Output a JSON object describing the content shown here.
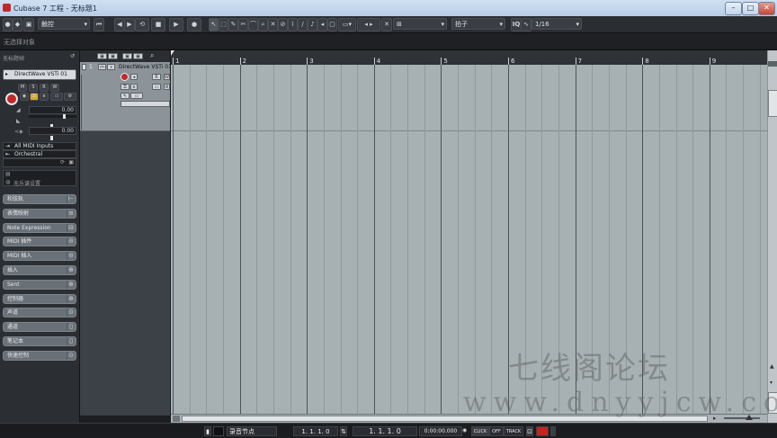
{
  "window": {
    "title": "Cubase 7 工程 - 无标题1",
    "min": "–",
    "max": "□",
    "close": "✕"
  },
  "toolbar": {
    "mode_select": "触控",
    "quantize_type": "拍子",
    "quantize_label": "IQ",
    "quantize_value": "1/16"
  },
  "infoline": {
    "text": "无选择对象"
  },
  "inspector": {
    "header_label": "无标题帧",
    "track_name": "DirectWave VSTi 01",
    "volume_value": "0.00",
    "pan_value": "0.00",
    "input": "All MIDI Inputs",
    "output": "Orchestral",
    "chord_label": "无乐谱设置",
    "sections": [
      "和弦轨",
      "表情映射",
      "Note Expression",
      "MIDI 插件",
      "MIDI 插入",
      "插入",
      "Sent",
      "控制器",
      "声道",
      "通道",
      "笔记本",
      "快速控制"
    ]
  },
  "track": {
    "number": "1",
    "name": "DirectWave VSTi 01"
  },
  "ruler": {
    "bars": [
      "1",
      "2",
      "3",
      "4",
      "5",
      "6",
      "7",
      "8",
      "9"
    ]
  },
  "transport": {
    "marker_label": "录音节点",
    "left_locator": "1. 1. 1.  0",
    "position": "1. 1. 1.  0",
    "time": "0:00:00.000",
    "click_label": "CLICK",
    "click_state": "OFF",
    "tempo_label": "TRACK"
  },
  "watermark": {
    "line1": "七线阁论坛",
    "line2": "www.dnyyjcw.com"
  }
}
